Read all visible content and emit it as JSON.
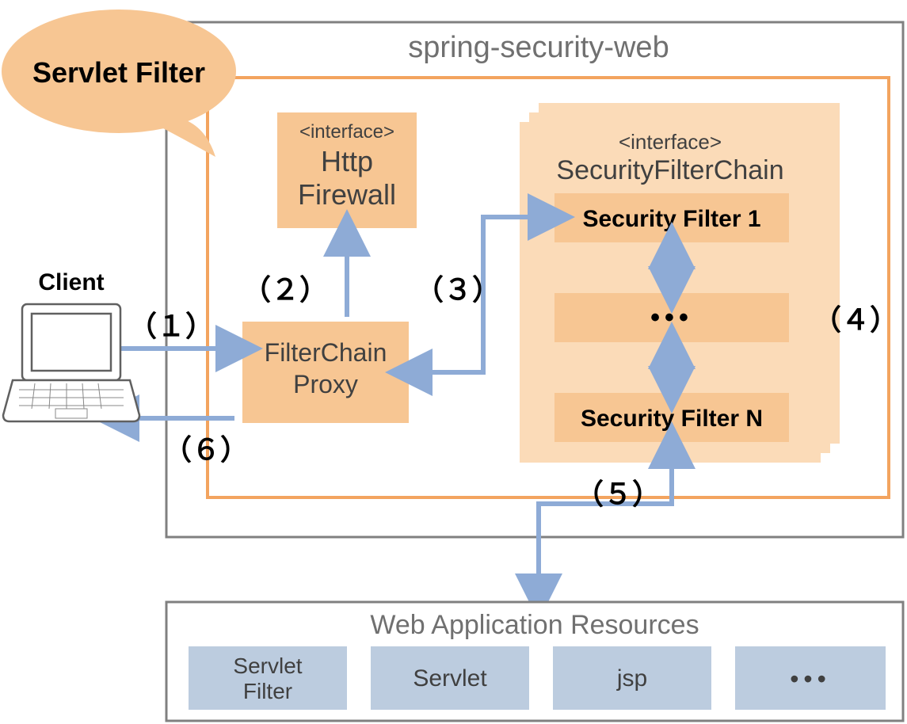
{
  "callout": {
    "label": "Servlet Filter"
  },
  "client": {
    "label": "Client"
  },
  "module": {
    "title": "spring-security-web"
  },
  "firewall": {
    "stereotype": "<interface>",
    "line1": "Http",
    "line2": "Firewall"
  },
  "proxy": {
    "line1": "FilterChain",
    "line2": "Proxy"
  },
  "chain": {
    "stereotype": "<interface>",
    "title": "SecurityFilterChain",
    "filter1": "Security Filter 1",
    "filterN": "Security Filter N",
    "dots": "•••"
  },
  "steps": {
    "s1": "（１）",
    "s2": "（２）",
    "s3": "（３）",
    "s4": "（４）",
    "s5": "（５）",
    "s6": "（６）"
  },
  "resources": {
    "title": "Web Application Resources",
    "items": [
      "Servlet\nFilter",
      "Servlet",
      "jsp",
      "•••"
    ]
  }
}
